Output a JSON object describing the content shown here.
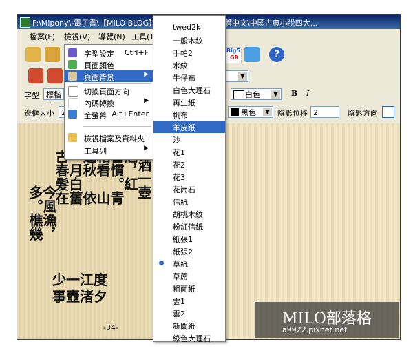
{
  "window": {
    "title": "F:\\Mipony\\-電子書\\【MILO BLOG】中文電子書【中文繁體中文\\中國古典小說四大..."
  },
  "menubar": {
    "items": [
      "檔案(F)",
      "檢視(V)",
      "導覽(N)",
      "工具(T)"
    ]
  },
  "toolbar": {
    "big5_label": "Big5",
    "gb_label": "GB",
    "font_label": "字型",
    "font_value": "標楷體",
    "color_value": "白色",
    "bold_label": "B",
    "italic_label": "I",
    "border_label": "邊框大小",
    "border_value": "2",
    "color2_value": "黑色",
    "shadow_offset_label": "陰影位移",
    "shadow_offset_value": "2",
    "shadow_dir_label": "陰影方向"
  },
  "view_menu": {
    "items": [
      {
        "label": "字型設定",
        "shortcut": "Ctrl+F"
      },
      {
        "label": "頁面顏色"
      },
      {
        "label": "頁面背景",
        "submenu": true,
        "selected": true
      },
      {
        "label": "切換頁面方向"
      },
      {
        "label": "內碼轉換",
        "submenu": true
      },
      {
        "label": "全螢幕",
        "shortcut": "Alt+Enter"
      },
      {
        "label": "檢視檔案及資料夾"
      },
      {
        "label": "工具列",
        "submenu": true
      }
    ]
  },
  "bg_submenu": {
    "items": [
      "twed2k",
      "一般木紋",
      "手帕2",
      "水紋",
      "牛仔布",
      "白色大理石",
      "再生紙",
      "帆布",
      "羊皮紙",
      "沙",
      "花1",
      "花2",
      "花3",
      "花崗石",
      "信紙",
      "胡桃木紋",
      "粉紅信紙",
      "紙張1",
      "紙張2",
      "草紙",
      "草蓆",
      "粗面紙",
      "雲1",
      "雲2",
      "新聞紙",
      "綠色大理石"
    ],
    "selected": "羊皮紙",
    "checked": "草紙"
  },
  "book": {
    "columns": [
      "，濁酒一壺",
      "都酒，紅",
      "付喜慣。青",
      "笑相看　山",
      "談逢秋　依",
      "中。月白舊",
      "。古春髮在",
      "今風漁，",
      "多。樵幾",
      "少一江度",
      "事壺渚夕"
    ],
    "page_number": "-34-"
  },
  "watermark": {
    "title": "MILO部落格",
    "url": "a9922.pixnet.net"
  }
}
